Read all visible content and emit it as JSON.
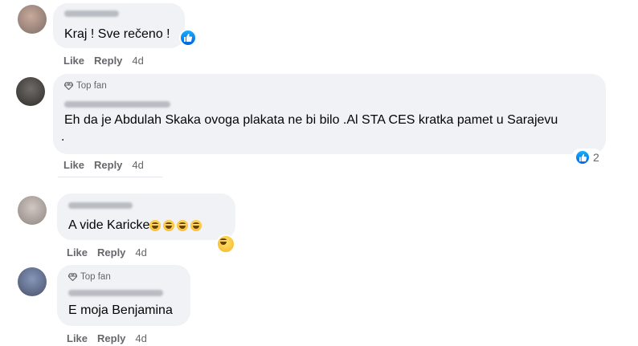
{
  "comments": [
    {
      "author": "",
      "top_fan": false,
      "text": "Kraj ! Sve rečeno !",
      "actions": {
        "like": "Like",
        "reply": "Reply",
        "time": "4d"
      }
    },
    {
      "author": "",
      "top_fan": true,
      "top_fan_label": "Top fan",
      "text_line1": "Eh da je Abdulah Skaka ovoga plakata ne bi bilo .Al STA CES kratka pamet u Sarajevu",
      "text_line2": ".",
      "reaction_count": "2",
      "actions": {
        "like": "Like",
        "reply": "Reply",
        "time": "4d"
      }
    },
    {
      "author": "",
      "top_fan": false,
      "text": "A vide Karicke",
      "actions": {
        "like": "Like",
        "reply": "Reply",
        "time": "4d"
      }
    },
    {
      "author": "",
      "top_fan": true,
      "top_fan_label": "Top fan",
      "text": "E moja Benjamina",
      "actions": {
        "like": "Like",
        "reply": "Reply",
        "time": "4d"
      }
    }
  ],
  "colors": {
    "bubble": "#f0f2f5",
    "meta": "#65676b",
    "like_blue": "#0866ff"
  },
  "icons": [
    "like-reaction-icon",
    "haha-emoji-icon",
    "diamond-top-fan-icon"
  ]
}
